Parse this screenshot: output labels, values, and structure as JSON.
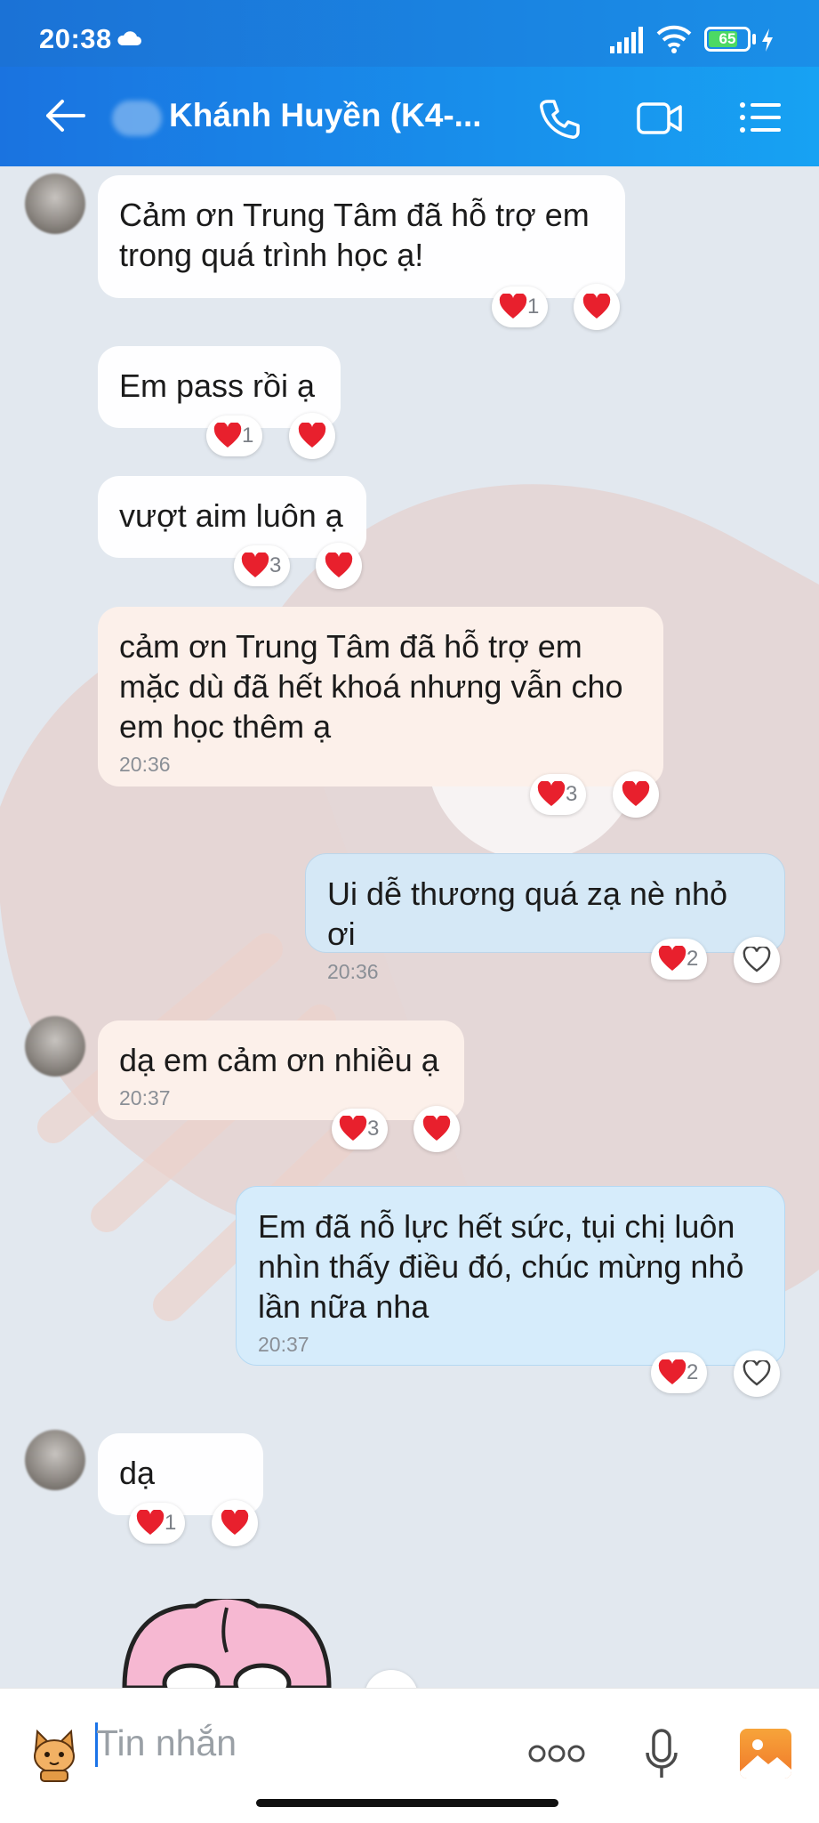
{
  "status_bar": {
    "time": "20:38",
    "battery": "65"
  },
  "header": {
    "title": "Khánh Huyền (K4-..."
  },
  "messages": [
    {
      "from": "them",
      "lines": [
        "Cảm ơn Trung Tâm đã hỗ trợ em",
        "trong quá trình học ạ!"
      ],
      "reaction_count": "1"
    },
    {
      "from": "them",
      "text": "Em pass rồi ạ",
      "reaction_count": "1"
    },
    {
      "from": "them",
      "text": "vượt aim luôn ạ",
      "reaction_count": "3"
    },
    {
      "from": "them",
      "lines": [
        "cảm ơn Trung Tâm đã hỗ trợ em",
        "mặc dù đã hết khoá nhưng vẫn cho",
        "em học thêm ạ"
      ],
      "time": "20:36",
      "reaction_count": "3"
    },
    {
      "from": "me",
      "text": "Ui dễ thương quá zạ nè nhỏ ơi",
      "time": "20:36",
      "reaction_count": "2"
    },
    {
      "from": "them",
      "text": "dạ em cảm ơn nhiều ạ",
      "time": "20:37",
      "reaction_count": "3"
    },
    {
      "from": "me",
      "lines": [
        "Em đã nỗ lực hết sức, tụi chị luôn",
        "nhìn thấy điều đó, chúc mừng nhỏ",
        "lần nữa nha"
      ],
      "time": "20:37",
      "reaction_count": "2"
    },
    {
      "from": "them",
      "text": "dạ",
      "reaction_count": "1"
    }
  ],
  "input": {
    "placeholder": "Tin nhắn"
  },
  "icons": {
    "back": "arrow-left-icon",
    "call": "phone-icon",
    "video": "video-camera-icon",
    "menu": "list-menu-icon",
    "sticker": "cat-sticker-icon",
    "more": "more-dots-icon",
    "mic": "microphone-icon",
    "gallery": "image-gallery-icon"
  },
  "colors": {
    "header": "#1a8fe8",
    "heart": "#e8202d",
    "gallery": "#f58a1f"
  }
}
